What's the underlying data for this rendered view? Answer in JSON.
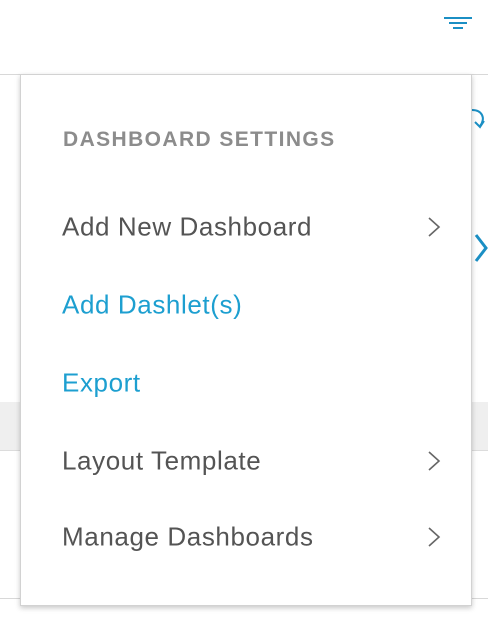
{
  "header": {
    "filter_icon": "filter-icon"
  },
  "background": {
    "refresh_icon": "refresh-icon",
    "next_icon": "chevron-right-icon"
  },
  "menu": {
    "heading": "DASHBOARD SETTINGS",
    "items": [
      {
        "label": "Add New Dashboard",
        "submenu": true,
        "style": "default"
      },
      {
        "label": "Add Dashlet(s)",
        "submenu": false,
        "style": "link"
      },
      {
        "label": "Export",
        "submenu": false,
        "style": "link"
      },
      {
        "label": "Layout Template",
        "submenu": true,
        "style": "default"
      },
      {
        "label": "Manage Dashboards",
        "submenu": true,
        "style": "default"
      }
    ]
  },
  "colors": {
    "accent": "#1d9fd0",
    "text": "#545454",
    "heading": "#8c8c8c",
    "icon_blue": "#1b8fc4"
  }
}
